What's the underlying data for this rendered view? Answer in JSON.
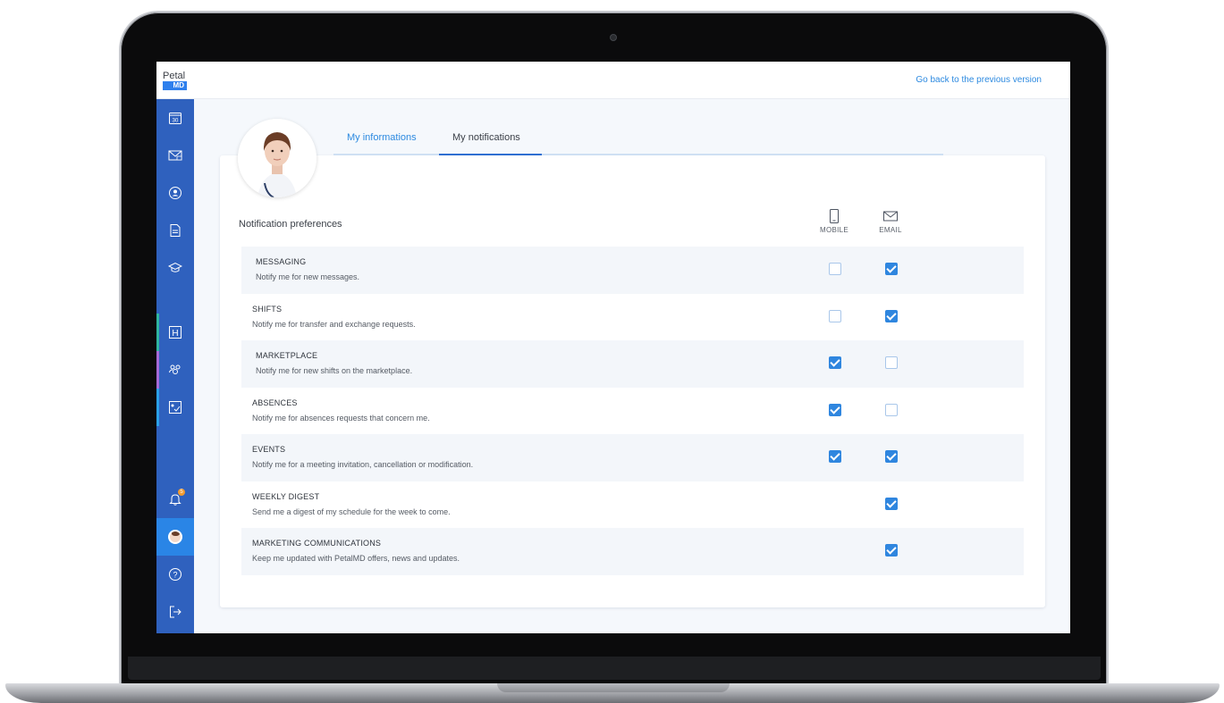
{
  "header": {
    "logo_top": "Petal",
    "logo_bottom": "MD",
    "go_back_link": "Go back to the previous version"
  },
  "sidebar": {
    "items": [
      {
        "icon": "calendar-icon",
        "label": "30"
      },
      {
        "icon": "mail-lock-icon"
      },
      {
        "icon": "user-circle-icon"
      },
      {
        "icon": "document-icon"
      },
      {
        "icon": "graduation-cap-icon"
      },
      {
        "icon": "hospital-icon",
        "label": "H",
        "marker_color": "#2fb5a0"
      },
      {
        "icon": "team-icon",
        "marker_color": "#a56ad8"
      },
      {
        "icon": "chart-board-icon",
        "marker_color": "#2aa0e8"
      },
      {
        "icon": "bell-icon",
        "badge": "5"
      },
      {
        "icon": "profile-avatar-icon",
        "active": true
      },
      {
        "icon": "help-icon",
        "label": "?"
      },
      {
        "icon": "logout-icon"
      }
    ]
  },
  "tabs": [
    {
      "label": "My informations",
      "active": false
    },
    {
      "label": "My notifications",
      "active": true
    }
  ],
  "notifications": {
    "title": "Notification preferences",
    "columns": {
      "mobile": "MOBILE",
      "email": "EMAIL"
    },
    "rows": [
      {
        "title": "MESSAGING",
        "desc": "Notify me for new messages.",
        "mobile": false,
        "email": true
      },
      {
        "title": "SHIFTS",
        "desc": "Notify me for transfer and exchange requests.",
        "mobile": false,
        "email": true
      },
      {
        "title": "MARKETPLACE",
        "desc": "Notify me for new shifts on the marketplace.",
        "mobile": true,
        "email": false
      },
      {
        "title": "ABSENCES",
        "desc": "Notify me for absences requests that concern me.",
        "mobile": true,
        "email": false
      },
      {
        "title": "EVENTS",
        "desc": "Notify me for a meeting invitation, cancellation or modification.",
        "mobile": true,
        "email": true
      },
      {
        "title": "WEEKLY DIGEST",
        "desc": "Send me a digest of my schedule for the week to come.",
        "mobile": null,
        "email": true
      },
      {
        "title": "MARKETING COMMUNICATIONS",
        "desc": "Keep me updated with PetalMD offers, news and updates.",
        "mobile": null,
        "email": true
      }
    ]
  },
  "colors": {
    "sidebar": "#2f61be",
    "accent": "#2f86df",
    "link": "#2d8ae0"
  }
}
